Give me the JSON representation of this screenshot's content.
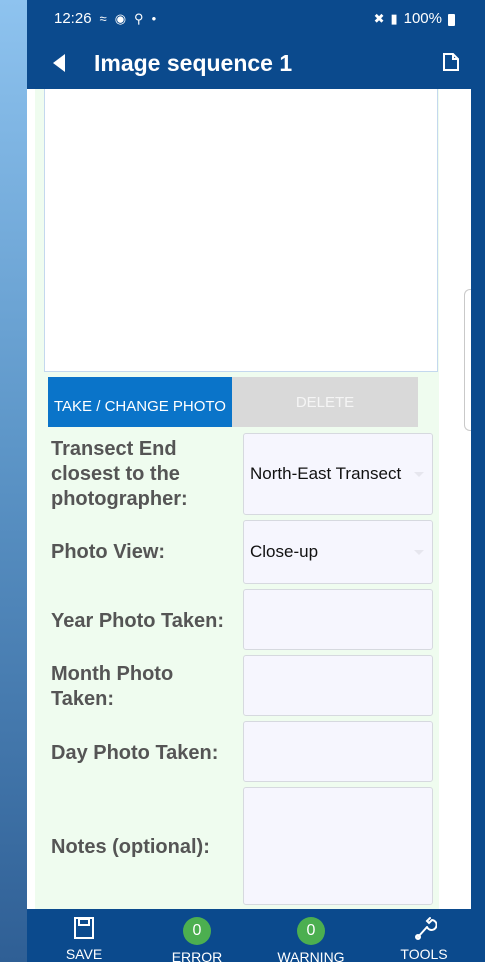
{
  "status_bar": {
    "time": "12:26",
    "left_icons": [
      "wifi-calling-icon",
      "target-icon",
      "location-icon",
      "dot-icon"
    ],
    "right_icons": [
      "mute-icon",
      "signal-icon"
    ],
    "battery": "100%"
  },
  "app_bar": {
    "title": "Image sequence 1"
  },
  "photo": {
    "take_label": "TAKE / CHANGE PHOTO",
    "delete_label": "DELETE"
  },
  "form": {
    "transect_end_label": "Transect End closest to the photographer:",
    "transect_end_value": "North-East Transect",
    "photo_view_label": "Photo View:",
    "photo_view_value": "Close-up",
    "year_label": "Year Photo Taken:",
    "year_value": "",
    "month_label": "Month Photo Taken:",
    "month_value": "",
    "day_label": "Day Photo Taken:",
    "day_value": "",
    "notes_label": "Notes (optional):",
    "notes_value": ""
  },
  "bottom_nav": {
    "save_label": "SAVE",
    "error_label": "ERROR",
    "error_count": "0",
    "warning_label": "WARNING",
    "warning_count": "0",
    "tools_label": "TOOLS"
  },
  "colors": {
    "primary": "#0b4a8d",
    "button_blue": "#0a74c9",
    "form_bg": "#effcef",
    "badge_green": "#4caf50"
  }
}
